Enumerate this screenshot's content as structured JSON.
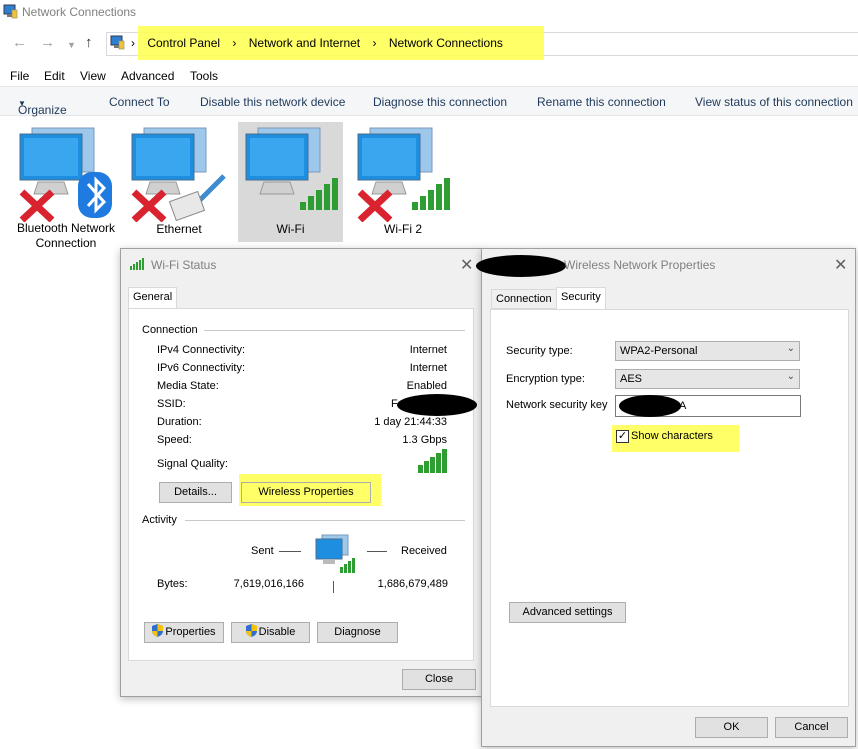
{
  "window": {
    "title": "Network Connections"
  },
  "breadcrumb": [
    "Control Panel",
    "Network and Internet",
    "Network Connections"
  ],
  "menu": [
    "File",
    "Edit",
    "View",
    "Advanced",
    "Tools"
  ],
  "toolbar": {
    "organize": "Organize",
    "items": [
      "Connect To",
      "Disable this network device",
      "Diagnose this connection",
      "Rename this connection",
      "View status of this connection"
    ]
  },
  "connections": [
    {
      "name": "Bluetooth Network Connection",
      "icon": "bluetooth-icon",
      "status": "disconnected"
    },
    {
      "name": "Ethernet",
      "icon": "ethernet-cable-icon",
      "status": "disconnected"
    },
    {
      "name": "Wi-Fi",
      "icon": "wifi-signal-icon",
      "status": "connected"
    },
    {
      "name": "Wi-Fi 2",
      "icon": "wifi-signal-icon",
      "status": "disconnected"
    }
  ],
  "wifi_status": {
    "title": "Wi-Fi Status",
    "tab": "General",
    "connection_group": "Connection",
    "ipv4_label": "IPv4 Connectivity:",
    "ipv4_value": "Internet",
    "ipv6_label": "IPv6 Connectivity:",
    "ipv6_value": "Internet",
    "media_label": "Media State:",
    "media_value": "Enabled",
    "ssid_label": "SSID:",
    "ssid_value": "F",
    "duration_label": "Duration:",
    "duration_value": "1 day 21:44:33",
    "speed_label": "Speed:",
    "speed_value": "1.3 Gbps",
    "signal_label": "Signal Quality:",
    "details_button": "Details...",
    "wireless_props_button": "Wireless Properties",
    "activity_group": "Activity",
    "sent_label": "Sent",
    "received_label": "Received",
    "bytes_label": "Bytes:",
    "bytes_sent": "7,619,016,166",
    "bytes_received": "1,686,679,489",
    "properties_button": "Properties",
    "disable_button": "Disable",
    "diagnose_button": "Diagnose",
    "close_button": "Close"
  },
  "wireless_props": {
    "title": "Wireless Network Properties",
    "tabs": [
      "Connection",
      "Security"
    ],
    "security_type_label": "Security type:",
    "security_type_value": "WPA2-Personal",
    "encryption_label": "Encryption type:",
    "encryption_value": "AES",
    "key_label": "Network security key",
    "key_value": "A",
    "show_chars_label": "Show characters",
    "advanced_button": "Advanced settings",
    "ok_button": "OK",
    "cancel_button": "Cancel"
  },
  "colors": {
    "highlight": "#ffff4d",
    "selection": "#d9d9d9",
    "monitor_blue": "#1e8fe0",
    "signal_green": "#2e9d32",
    "error_red": "#d9232e"
  }
}
